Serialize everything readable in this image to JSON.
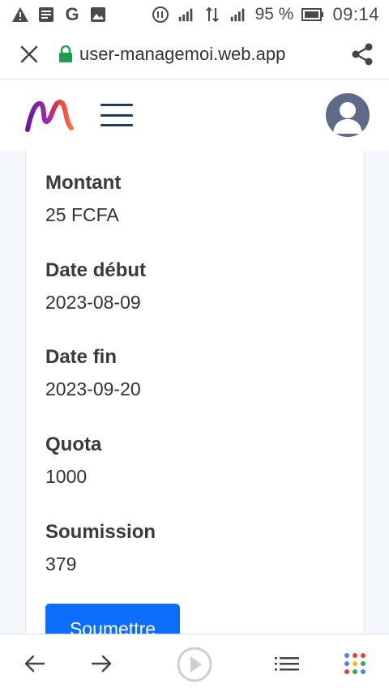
{
  "status_bar": {
    "battery": "95 %",
    "time": "09:14",
    "icons_left": [
      "warning-icon",
      "message-icon",
      "google-icon",
      "image-icon"
    ],
    "icons_right": [
      "data-saver-icon",
      "signal-e-icon",
      "data-transfer-icon",
      "signal-h-icon",
      "battery-icon"
    ]
  },
  "browser": {
    "url": "user-managemoi.web.app"
  },
  "app_header": {
    "logo": "app-logo-m",
    "menu_icon": "hamburger-icon",
    "avatar_icon": "user-avatar"
  },
  "fields": [
    {
      "label": "Montant",
      "value": "25 FCFA"
    },
    {
      "label": "Date début",
      "value": "2023-08-09"
    },
    {
      "label": "Date fin",
      "value": "2023-09-20"
    },
    {
      "label": "Quota",
      "value": "1000"
    },
    {
      "label": "Soumission",
      "value": "379"
    }
  ],
  "submit_label": "Soumettre",
  "colors": {
    "primary_button": "#0d6efd",
    "page_background": "#f4f7fb",
    "secure_lock": "#1e9e4a",
    "hamburger": "#1f3b63"
  },
  "bottom_nav": [
    "back-arrow-icon",
    "forward-arrow-icon",
    "play-icon",
    "list-icon",
    "apps-dots-icon"
  ]
}
